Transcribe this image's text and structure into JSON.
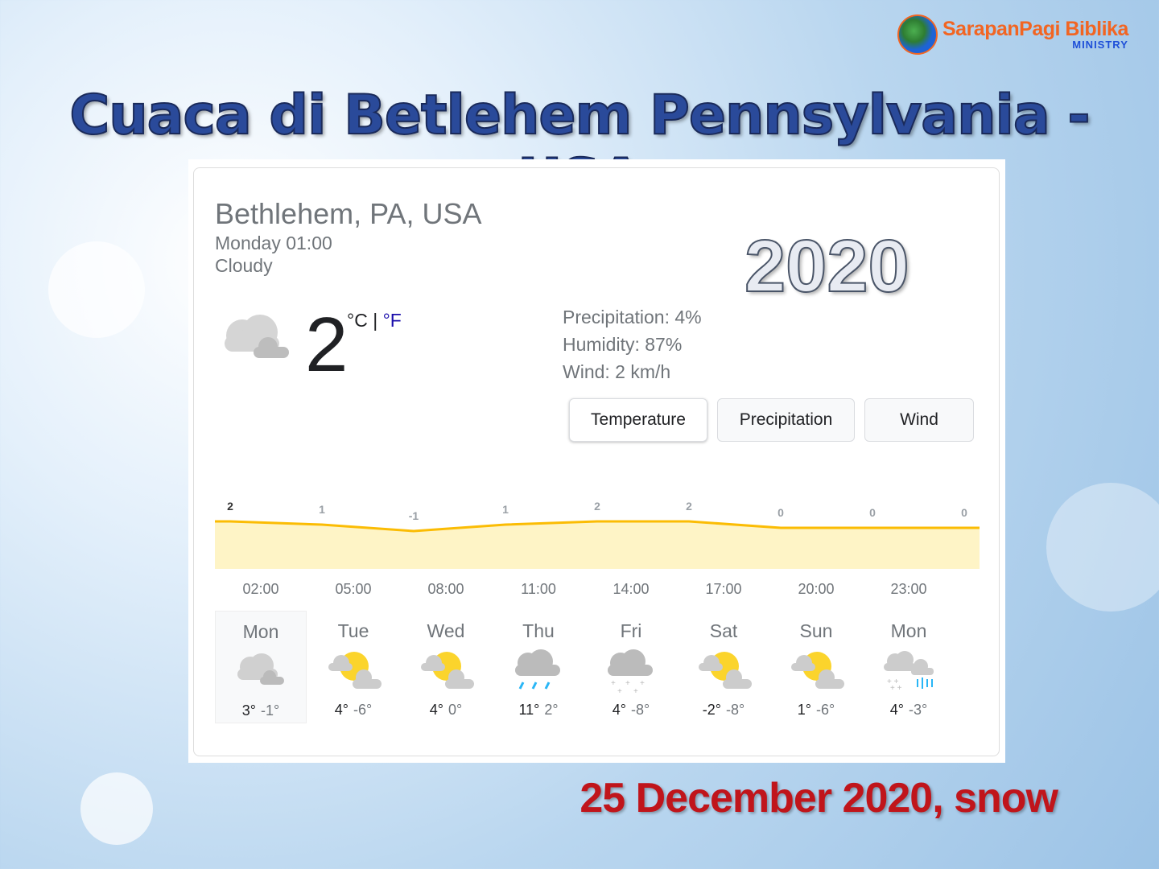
{
  "logo": {
    "main": "SarapanPagi Biblika",
    "sub": "MINISTRY"
  },
  "title": "Cuaca di Betlehem Pennsylvania - USA",
  "year": "2020",
  "weather": {
    "location": "Bethlehem, PA, USA",
    "time": "Monday 01:00",
    "condition": "Cloudy",
    "temp": "2",
    "unit_c": "°C",
    "sep": " | ",
    "unit_f": "°F",
    "precipitation": "Precipitation: 4%",
    "humidity": "Humidity: 87%",
    "wind": "Wind: 2 km/h",
    "tabs": [
      {
        "label": "Temperature",
        "selected": true
      },
      {
        "label": "Precipitation"
      },
      {
        "label": "Wind"
      }
    ]
  },
  "chart_data": {
    "type": "area",
    "values": [
      2,
      1,
      -1,
      1,
      2,
      2,
      0,
      0,
      0
    ],
    "labels": [
      "2",
      "1",
      "-1",
      "1",
      "2",
      "2",
      "0",
      "0",
      "0"
    ],
    "times": [
      "02:00",
      "05:00",
      "08:00",
      "11:00",
      "14:00",
      "17:00",
      "20:00",
      "23:00"
    ],
    "color": "#fbbc04",
    "fill": "#fef4c6"
  },
  "forecast": [
    {
      "day": "Mon",
      "icon": "cloudy",
      "high": "3°",
      "low": "-1°"
    },
    {
      "day": "Tue",
      "icon": "partly-sunny",
      "high": "4°",
      "low": "-6°"
    },
    {
      "day": "Wed",
      "icon": "partly-sunny",
      "high": "4°",
      "low": "0°"
    },
    {
      "day": "Thu",
      "icon": "rain",
      "high": "11°",
      "low": "2°"
    },
    {
      "day": "Fri",
      "icon": "snow",
      "high": "4°",
      "low": "-8°"
    },
    {
      "day": "Sat",
      "icon": "partly-sunny",
      "high": "-2°",
      "low": "-8°"
    },
    {
      "day": "Sun",
      "icon": "partly-sunny",
      "high": "1°",
      "low": "-6°"
    },
    {
      "day": "Mon",
      "icon": "snow-rain",
      "high": "4°",
      "low": "-3°"
    }
  ],
  "caption": "25 December 2020, snow"
}
